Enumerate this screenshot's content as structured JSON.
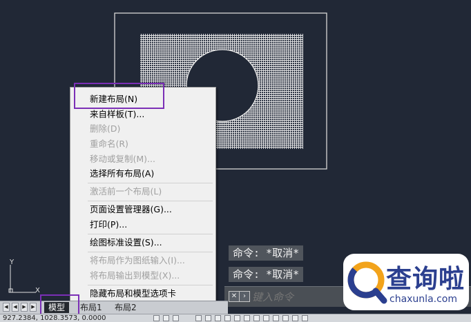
{
  "context_menu": {
    "items": [
      {
        "label": "新建布局(N)",
        "enabled": true
      },
      {
        "label": "来自样板(T)...",
        "enabled": true
      },
      {
        "label": "删除(D)",
        "enabled": false
      },
      {
        "label": "重命名(R)",
        "enabled": false
      },
      {
        "label": "移动或复制(M)...",
        "enabled": false
      },
      {
        "label": "选择所有布局(A)",
        "enabled": true
      },
      {
        "label": "激活前一个布局(L)",
        "enabled": false
      },
      {
        "label": "页面设置管理器(G)...",
        "enabled": true
      },
      {
        "label": "打印(P)...",
        "enabled": true
      },
      {
        "label": "绘图标准设置(S)...",
        "enabled": true
      },
      {
        "label": "将布局作为图纸输入(I)...",
        "enabled": false
      },
      {
        "label": "将布局输出到模型(X)...",
        "enabled": false
      },
      {
        "label": "隐藏布局和模型选项卡",
        "enabled": true
      }
    ]
  },
  "command_history": [
    "命令: *取消*",
    "命令: *取消*"
  ],
  "command_line": {
    "placeholder": "键入命令"
  },
  "tabs": [
    {
      "label": "模型",
      "active": true
    },
    {
      "label": "布局1",
      "active": false
    },
    {
      "label": "布局2",
      "active": false
    }
  ],
  "ucs": {
    "x_label": "X",
    "y_label": "Y"
  },
  "status": {
    "coordinates": "927.2384, 1028.3573, 0.0000"
  },
  "watermark": {
    "text": "查询啦",
    "sub": "chaxunla.com"
  },
  "colors": {
    "canvas_bg": "#212836",
    "highlight": "#7b2fb6",
    "logo_blue": "#2b3f8f"
  }
}
